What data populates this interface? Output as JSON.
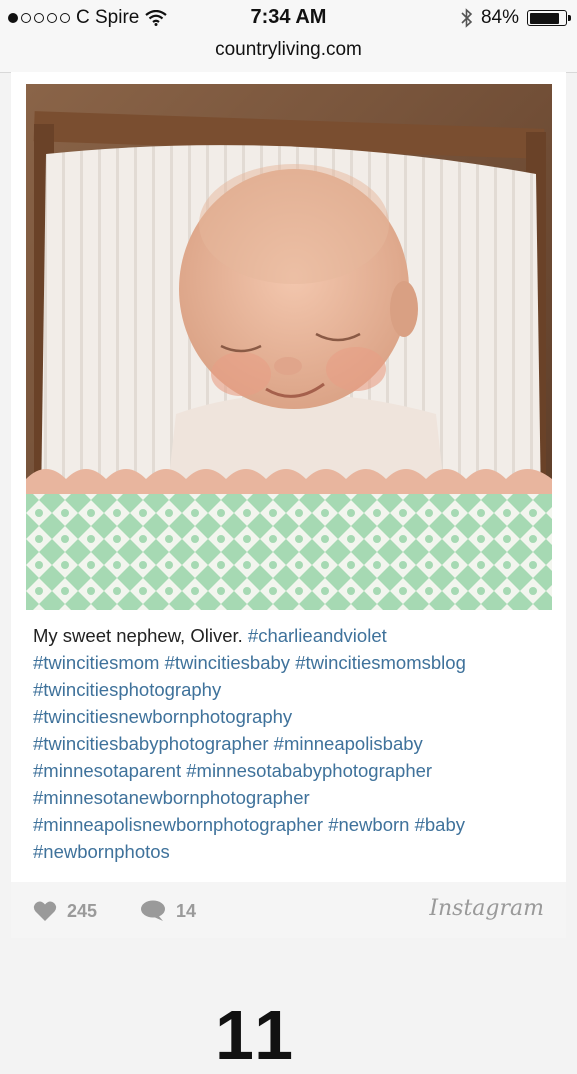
{
  "status_bar": {
    "carrier": "C Spire",
    "time": "7:34 AM",
    "battery": "84%",
    "battery_level": 0.84
  },
  "browser": {
    "url": "countryliving.com"
  },
  "post": {
    "image_alt": "Sleeping newborn baby swaddled in a wooden crate",
    "caption_text": "My sweet nephew, Oliver.",
    "hashtags": [
      "#charlieandviolet",
      "#twincitiesmom",
      "#twincitiesbaby",
      "#twincitiesmomsblog",
      "#twincitiesphotography",
      "#twincitiesnewbornphotography",
      "#twincitiesbabyphotographer",
      "#minneapolisbaby",
      "#minnesotaparent",
      "#minnesotababyphotographer",
      "#minnesotanewbornphotographer",
      "#minneapolisnewbornphotographer",
      "#newborn",
      "#baby",
      "#newbornphotos"
    ],
    "likes": "245",
    "comments": "14",
    "brand": "Instagram"
  },
  "below_content": "11",
  "icons": [
    "wifi-icon",
    "bluetooth-icon",
    "battery-icon",
    "heart-icon",
    "comment-icon"
  ]
}
